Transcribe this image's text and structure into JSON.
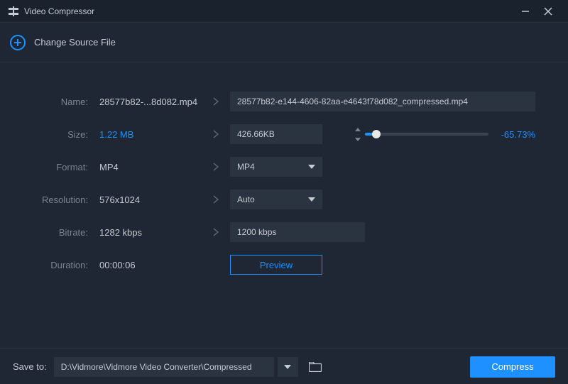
{
  "app": {
    "title": "Video Compressor"
  },
  "source": {
    "label": "Change Source File"
  },
  "name": {
    "label": "Name:",
    "original": "28577b82-...8d082.mp4",
    "output": "28577b82-e144-4606-82aa-e4643f78d082_compressed.mp4"
  },
  "size": {
    "label": "Size:",
    "original": "1.22 MB",
    "target": "426.66KB",
    "reduction": "-65.73%"
  },
  "format": {
    "label": "Format:",
    "original": "MP4",
    "target": "MP4"
  },
  "resolution": {
    "label": "Resolution:",
    "original": "576x1024",
    "target": "Auto"
  },
  "bitrate": {
    "label": "Bitrate:",
    "original": "1282 kbps",
    "target": "1200 kbps"
  },
  "duration": {
    "label": "Duration:",
    "value": "00:00:06"
  },
  "preview": "Preview",
  "footer": {
    "saveLabel": "Save to:",
    "path": "D:\\Vidmore\\Vidmore Video Converter\\Compressed",
    "compress": "Compress"
  }
}
